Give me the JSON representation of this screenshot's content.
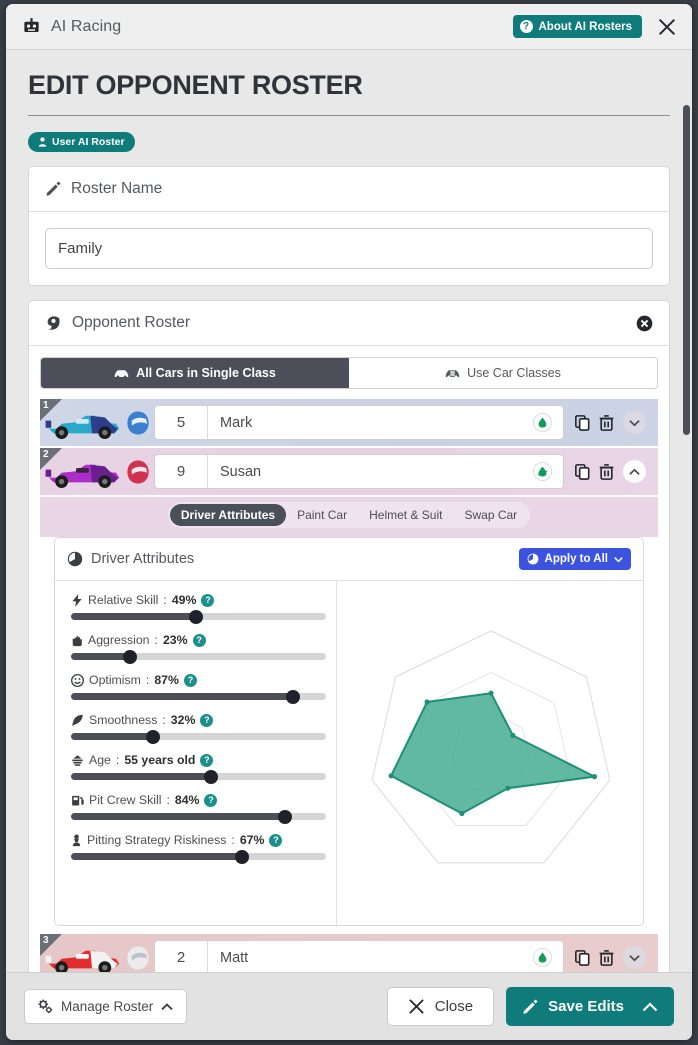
{
  "window": {
    "app_title": "AI Racing",
    "robot_icon": "robot-icon",
    "about_button": "About AI Rosters",
    "about_icon": "question-mark-icon",
    "close_icon": "close-x-icon"
  },
  "page": {
    "title": "EDIT OPPONENT ROSTER",
    "badge": "User AI Roster",
    "badge_icon": "user-icon"
  },
  "roster_name_card": {
    "header": "Roster Name",
    "header_icon": "pencil-icon",
    "value": "Family",
    "placeholder": "Roster Name"
  },
  "opponent_card": {
    "header": "Opponent Roster",
    "header_icon": "steering-wheel-icon",
    "clear_icon": "clear-circle-x-icon",
    "class_modes": [
      {
        "label": "All Cars in Single Class",
        "icon": "car-icon",
        "active": true
      },
      {
        "label": "Use Car Classes",
        "icon": "car-classes-icon",
        "active": false
      }
    ]
  },
  "drivers": [
    {
      "index": "1",
      "number": "5",
      "name": "Mark",
      "fuel_icon": "fuel-drop-icon",
      "expanded": false,
      "tint": "tint-blue",
      "car_color": "#29a8c9",
      "car_color2": "#2b3f8c",
      "helmet_color": "#3c7fd0",
      "copy_icon": "copy-icon",
      "delete_icon": "trash-icon",
      "chevron_icon": "chevron-down-icon"
    },
    {
      "index": "2",
      "number": "9",
      "name": "Susan",
      "fuel_icon": "fuel-drop-icon",
      "expanded": true,
      "tint": "tint-pink",
      "car_color": "#ab2fc7",
      "car_color2": "#6a1f8e",
      "helmet_color": "#d0334f",
      "copy_icon": "copy-icon",
      "delete_icon": "trash-icon",
      "chevron_icon": "chevron-up-icon"
    },
    {
      "index": "3",
      "number": "2",
      "name": "Matt",
      "fuel_icon": "fuel-drop-icon",
      "expanded": false,
      "tint": "tint-red",
      "car_color": "#e02d2d",
      "car_color2": "#f0f0f0",
      "helmet_color": "#e8e8e8",
      "copy_icon": "copy-icon",
      "delete_icon": "trash-icon",
      "chevron_icon": "chevron-down-icon"
    }
  ],
  "driver_subtabs": [
    {
      "label": "Driver Attributes",
      "active": true
    },
    {
      "label": "Paint Car",
      "active": false
    },
    {
      "label": "Helmet & Suit",
      "active": false
    },
    {
      "label": "Swap Car",
      "active": false
    }
  ],
  "attributes_panel": {
    "title": "Driver Attributes",
    "title_icon": "gauge-icon",
    "apply_button": "Apply to All",
    "apply_icon": "gauge-icon",
    "apply_chevron": "chevron-down-icon",
    "help_glyph": "?",
    "accent_help": "#1a8f8b",
    "accent_apply": "#3b53df",
    "sliders": [
      {
        "icon": "lightning-icon",
        "label": "Relative Skill",
        "value_text": "49%",
        "percent": 49
      },
      {
        "icon": "fist-icon",
        "label": "Aggression",
        "value_text": "23%",
        "percent": 23
      },
      {
        "icon": "smiley-icon",
        "label": "Optimism",
        "value_text": "87%",
        "percent": 87
      },
      {
        "icon": "feather-icon",
        "label": "Smoothness",
        "value_text": "32%",
        "percent": 32
      },
      {
        "icon": "age-icon",
        "label": "Age",
        "value_text": "55 years old",
        "percent": 55
      },
      {
        "icon": "pit-crew-icon",
        "label": "Pit Crew Skill",
        "value_text": "84%",
        "percent": 84
      },
      {
        "icon": "chess-pawn-icon",
        "label": "Pitting Strategy Riskiness",
        "value_text": "67%",
        "percent": 67
      }
    ]
  },
  "chart_data": {
    "type": "radar",
    "title": "",
    "axes": [
      "Relative Skill",
      "Aggression",
      "Optimism",
      "Smoothness",
      "Age",
      "Pit Crew Skill",
      "Pitting Strategy Riskiness"
    ],
    "values": [
      49,
      23,
      87,
      32,
      55,
      84,
      67
    ],
    "max": 100,
    "rings": [
      33,
      66,
      100
    ],
    "fill_color": "#3fa98c",
    "stroke_color": "#1f8f77",
    "grid_color": "#d8d8d8",
    "legend": "none"
  },
  "footer": {
    "manage_button": "Manage Roster",
    "manage_icon": "gears-icon",
    "manage_chevron": "chevron-up-icon",
    "close_button": "Close",
    "close_icon": "x-icon",
    "save_button": "Save Edits",
    "save_icon": "pencil-icon",
    "save_chevron": "chevron-up-icon",
    "accent": "#0f7b7b"
  }
}
